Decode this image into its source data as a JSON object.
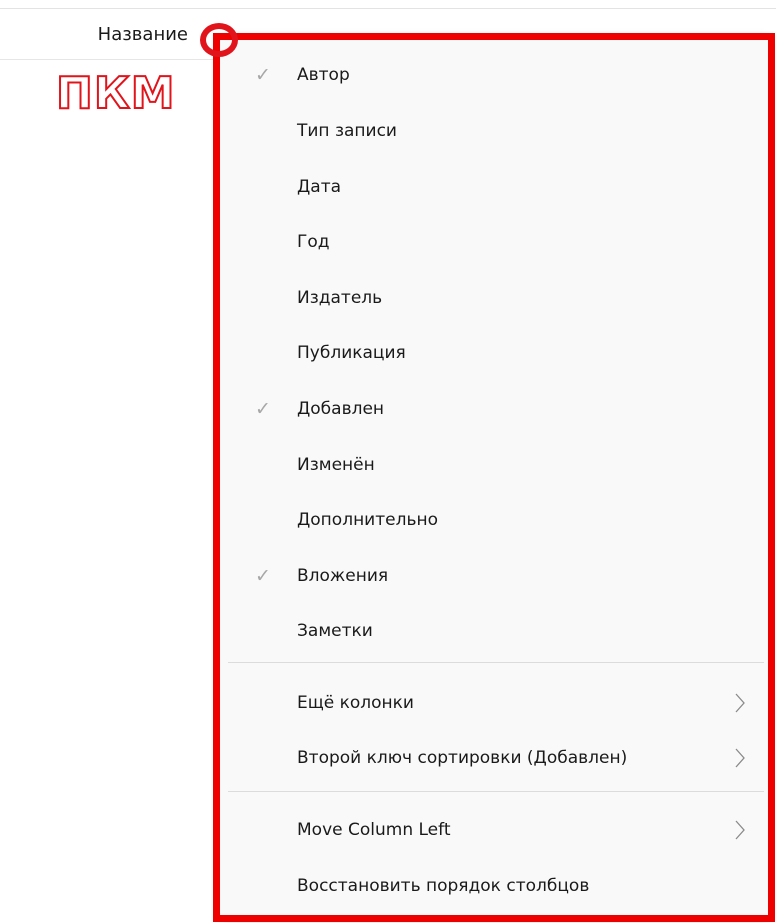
{
  "column_header": {
    "label": "Название"
  },
  "annotation": {
    "text": "ПКМ"
  },
  "context_menu": {
    "items": [
      {
        "label": "Автор",
        "checked": true
      },
      {
        "label": "Тип записи",
        "checked": false
      },
      {
        "label": "Дата",
        "checked": false
      },
      {
        "label": "Год",
        "checked": false
      },
      {
        "label": "Издатель",
        "checked": false
      },
      {
        "label": "Публикация",
        "checked": false
      },
      {
        "label": "Добавлен",
        "checked": true
      },
      {
        "label": "Изменён",
        "checked": false
      },
      {
        "label": "Дополнительно",
        "checked": false
      },
      {
        "label": "Вложения",
        "checked": true
      },
      {
        "label": "Заметки",
        "checked": false
      }
    ],
    "more_columns": "Ещё колонки",
    "secondary_sort": "Второй ключ сортировки (Добавлен)",
    "move_column_left": "Move Column Left",
    "restore_order": "Восстановить порядок столбцов",
    "check_glyph": "✓"
  },
  "colors": {
    "highlight_red": "#e1141b",
    "frame_red": "#ef0000",
    "menu_background": "#f9f9f9"
  }
}
